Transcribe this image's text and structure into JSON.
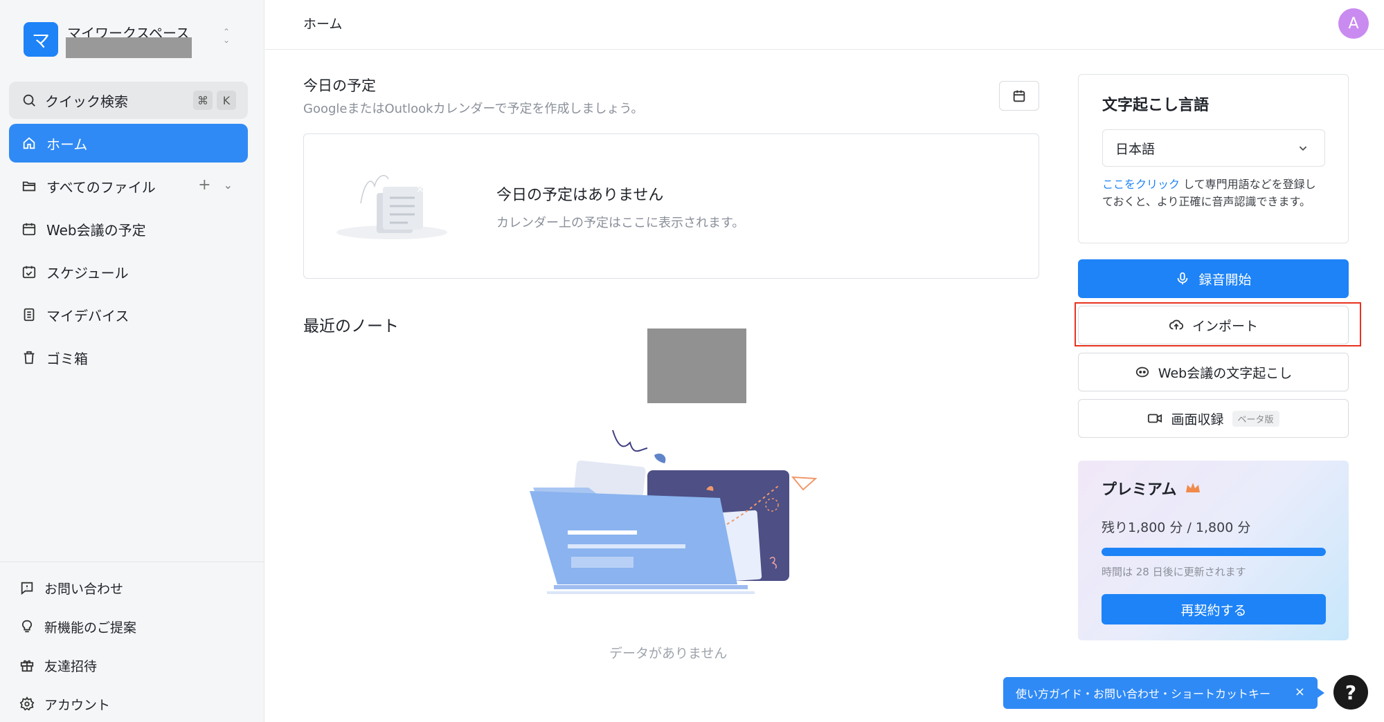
{
  "workspace": {
    "logo_letter": "マ",
    "name": "マイワークスペース"
  },
  "search": {
    "label": "クイック検索",
    "key1": "⌘",
    "key2": "K"
  },
  "nav": {
    "home": "ホーム",
    "files": "すべてのファイル",
    "web_meetings": "Web会議の予定",
    "schedule": "スケジュール",
    "devices": "マイデバイス",
    "trash": "ゴミ箱"
  },
  "bottom_nav": {
    "contact": "お問い合わせ",
    "feature_request": "新機能のご提案",
    "invite": "友達招待",
    "account": "アカウント"
  },
  "header": {
    "breadcrumb": "ホーム",
    "avatar_letter": "A"
  },
  "today": {
    "title": "今日の予定",
    "subtitle": "GoogleまたはOutlookカレンダーで予定を作成しましょう。",
    "empty_title": "今日の予定はありません",
    "empty_desc": "カレンダー上の予定はここに表示されます。"
  },
  "recent": {
    "title": "最近のノート",
    "empty": "データがありません"
  },
  "language": {
    "title": "文字起こし言語",
    "selected": "日本語",
    "note_link": "ここをクリック",
    "note_text": " して専門用語などを登録しておくと、より正確に音声認識できます。"
  },
  "actions": {
    "record": "録音開始",
    "import": "インポート",
    "web_transcribe": "Web会議の文字起こし",
    "screen_record": "画面収録",
    "beta_badge": "ベータ版"
  },
  "premium": {
    "title": "プレミアム",
    "remaining": "残り1,800 分 / 1,800 分",
    "remaining_fraction": 1.0,
    "renew_note": "時間は 28 日後に更新されます",
    "renew_button": "再契約する"
  },
  "guide": {
    "text": "使い方ガイド・お問い合わせ・ショートカットキー",
    "close": "×"
  },
  "help": {
    "label": "?"
  },
  "colors": {
    "accent": "#1d83f7",
    "highlight": "#e8321f",
    "avatar": "#c98bf0"
  }
}
